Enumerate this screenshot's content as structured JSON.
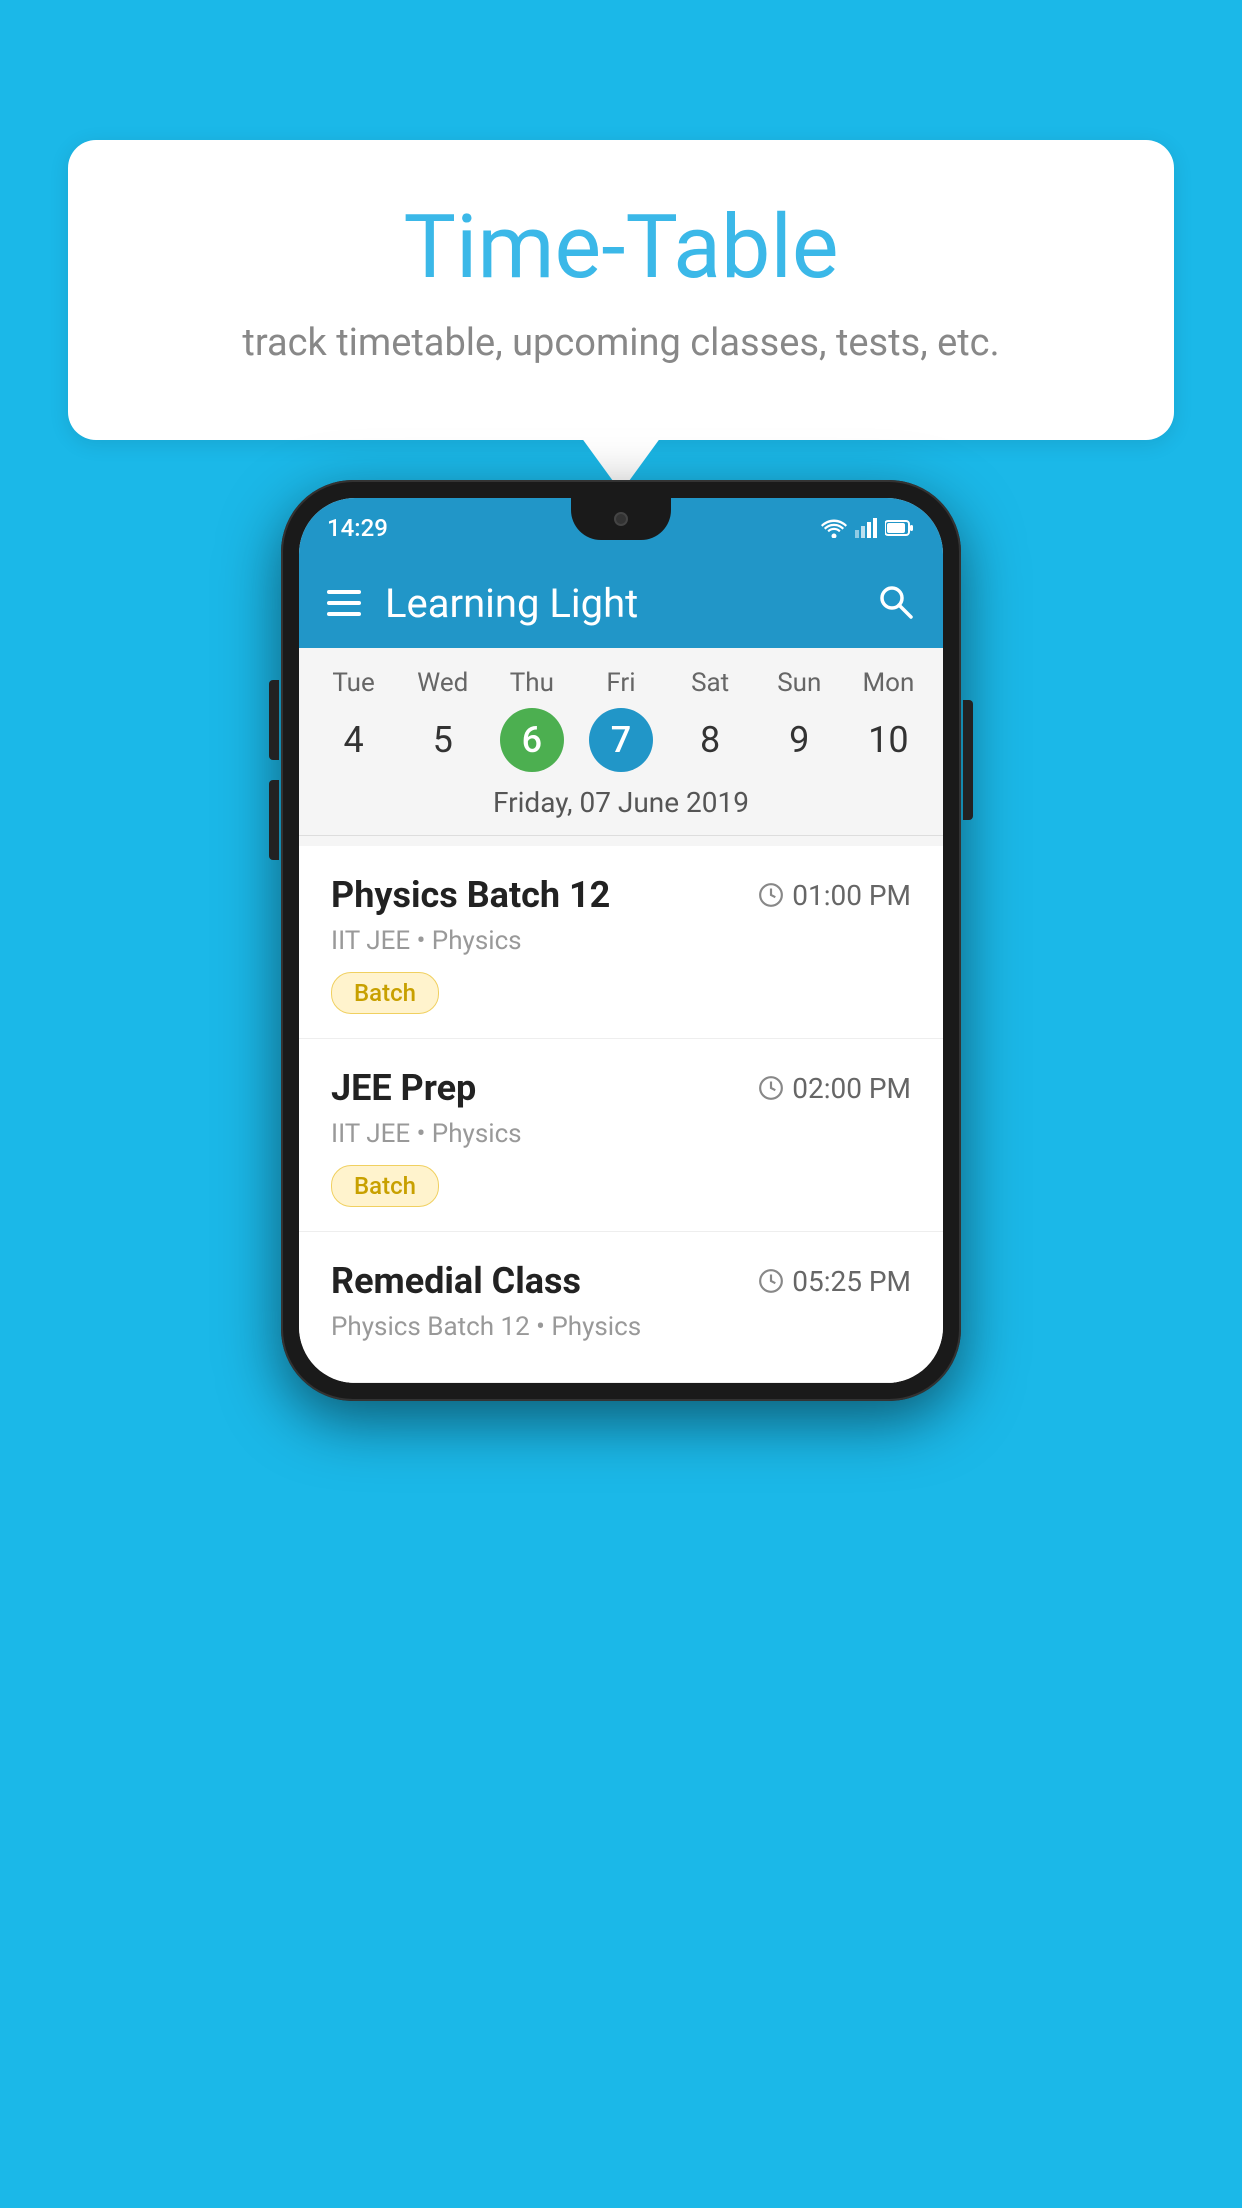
{
  "background_color": "#1BB8E8",
  "bubble": {
    "title": "Time-Table",
    "subtitle": "track timetable, upcoming classes, tests, etc."
  },
  "phone": {
    "status_bar": {
      "time": "14:29"
    },
    "app_bar": {
      "title": "Learning Light"
    },
    "calendar": {
      "days": [
        {
          "name": "Tue",
          "num": "4",
          "state": "normal"
        },
        {
          "name": "Wed",
          "num": "5",
          "state": "normal"
        },
        {
          "name": "Thu",
          "num": "6",
          "state": "today"
        },
        {
          "name": "Fri",
          "num": "7",
          "state": "selected"
        },
        {
          "name": "Sat",
          "num": "8",
          "state": "normal"
        },
        {
          "name": "Sun",
          "num": "9",
          "state": "normal"
        },
        {
          "name": "Mon",
          "num": "10",
          "state": "normal"
        }
      ],
      "selected_date_label": "Friday, 07 June 2019"
    },
    "classes": [
      {
        "name": "Physics Batch 12",
        "time": "01:00 PM",
        "subtitle": "IIT JEE • Physics",
        "badge": "Batch"
      },
      {
        "name": "JEE Prep",
        "time": "02:00 PM",
        "subtitle": "IIT JEE • Physics",
        "badge": "Batch"
      },
      {
        "name": "Remedial Class",
        "time": "05:25 PM",
        "subtitle": "Physics Batch 12 • Physics",
        "badge": null
      }
    ]
  }
}
